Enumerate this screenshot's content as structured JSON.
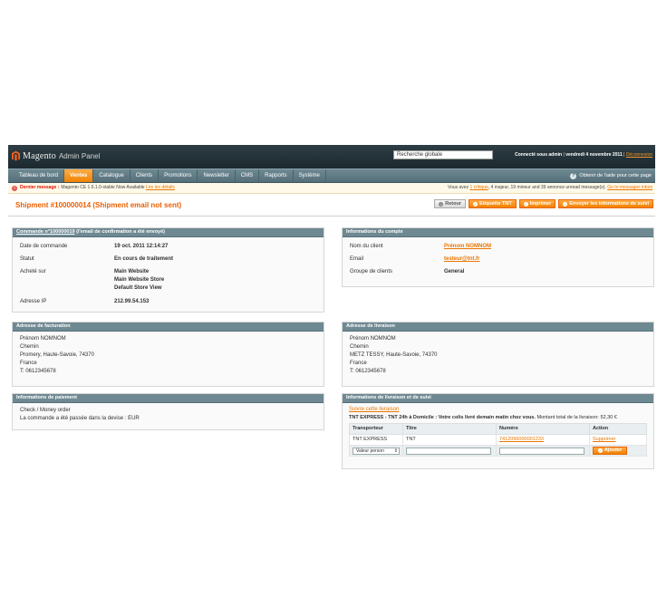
{
  "header": {
    "logo_text": "Magento",
    "logo_sub": "Admin Panel",
    "search_placeholder": "Recherche globale",
    "connected_prefix": "Connecté sous",
    "user": "admin",
    "date": "vendredi 4 novembre 2011",
    "logout": "Déconnexion"
  },
  "nav": {
    "items": [
      {
        "label": "Tableau de bord"
      },
      {
        "label": "Ventes"
      },
      {
        "label": "Catalogue"
      },
      {
        "label": "Clients"
      },
      {
        "label": "Promotions"
      },
      {
        "label": "Newsletter"
      },
      {
        "label": "CMS"
      },
      {
        "label": "Rapports"
      },
      {
        "label": "Système"
      }
    ],
    "active": "Ventes",
    "help": "Obtenir de l'aide pour cette page"
  },
  "message": {
    "label": "Dernier message :",
    "text": "Magento CE 1.6.1.0-stable Now Available",
    "details_link": "Lire les détails",
    "summary_prefix": "Vous avez",
    "critical_count": "1",
    "critical_word": "critique",
    "summary_rest": ", 4 majeur, 19 mineur and 39 annonce unread message(s).",
    "inbox_link": "Go to messages inbox"
  },
  "page": {
    "title": "Shipment #100000014 (Shipment email not sent)",
    "buttons": {
      "back": "Retour",
      "label": "Etiquette TNT",
      "print": "Imprimer",
      "send": "Envoyer les informations de suivi"
    }
  },
  "order_box": {
    "title_link": "Commande n°100000019",
    "title_rest": "(l'email de confirmation a été envoyé)",
    "rows": [
      {
        "k": "Date de commande",
        "v": "19 oct. 2011 12:14:27"
      },
      {
        "k": "Statut",
        "v": "En cours de traitement"
      }
    ],
    "bought_label": "Acheté sur",
    "bought_lines": [
      "Main Website",
      "Main Website Store",
      "Default Store View"
    ],
    "ip_label": "Adresse IP",
    "ip": "212.99.54.153"
  },
  "account_box": {
    "title": "Informations du compte",
    "name_label": "Nom du client",
    "name": "Prénom NOMNOM",
    "email_label": "Email",
    "email": "testeur@tnt.fr",
    "group_label": "Groupe de clients",
    "group": "General"
  },
  "billing_box": {
    "title": "Adresse de facturation",
    "lines": [
      "Prénom NOMNOM",
      "Chemin",
      "Promery, Haute-Savoie, 74370",
      "France",
      "T: 0612345678"
    ]
  },
  "shipping_box": {
    "title": "Adresse de livraison",
    "lines": [
      "Prénom NOMNOM",
      "Chemin",
      "METZ TESSY, Haute-Savoie, 74370",
      "France",
      "T: 0612345678"
    ]
  },
  "payment_box": {
    "title": "Informations de paiement",
    "lines": [
      "Check / Money order",
      "La commande a été passée dans la devise : EUR"
    ]
  },
  "tracking_box": {
    "title": "Informations de livraison et de suivi",
    "follow_link": "Suivre cette livraison",
    "method_bold": "TNT EXPRESS - TNT 24h à Domicile : Votre colis livré demain matin chez vous.",
    "total_text": "Montant total de la livraison: 52,30 €",
    "columns": [
      "Transporteur",
      "Titre",
      "Numéro",
      "Action"
    ],
    "row": {
      "carrier": "TNT EXPRESS",
      "title": "TNT",
      "number": "7412096000001233",
      "action": "Supprimer"
    },
    "select_value": "Valeur person",
    "add_button": "Ajouter"
  },
  "colors": {
    "accent": "#eb5e00",
    "nav": "#6f8992",
    "header": "#2d3d43"
  }
}
